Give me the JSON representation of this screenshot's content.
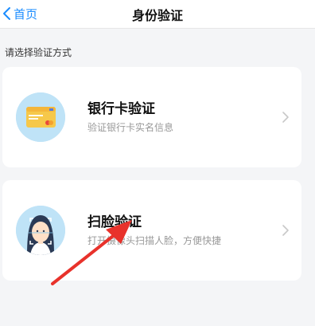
{
  "navbar": {
    "back_label": "首页",
    "title": "身份验证"
  },
  "section_hint": "请选择验证方式",
  "methods": [
    {
      "title": "银行卡验证",
      "subtitle": "验证银行卡实名信息",
      "icon": "bank-card-icon"
    },
    {
      "title": "扫脸验证",
      "subtitle": "打开摄像头扫描人脸，方便快捷",
      "icon": "face-scan-icon"
    }
  ],
  "colors": {
    "accent": "#1a8cff",
    "background": "#f4f5f7",
    "icon_bg": "#bfe3f7",
    "annotation_arrow": "#e8322b"
  }
}
